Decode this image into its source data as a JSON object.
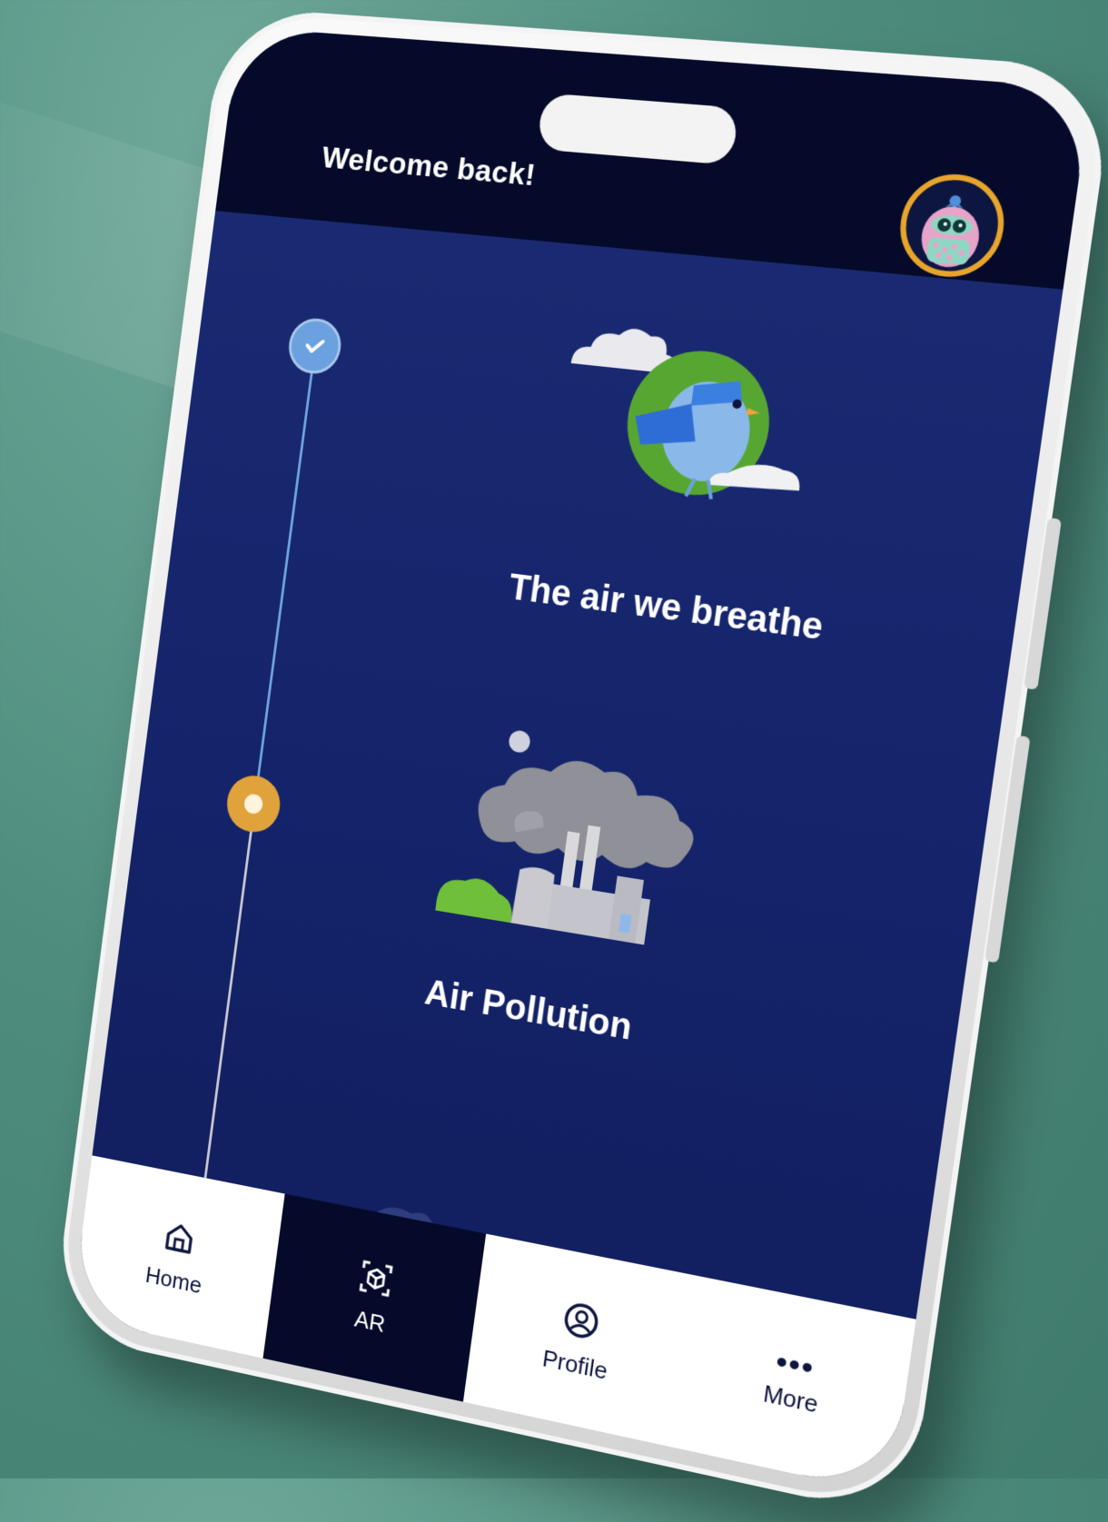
{
  "header": {
    "welcome_text": "Welcome back!"
  },
  "lessons": [
    {
      "title": "The air we breathe",
      "status": "completed"
    },
    {
      "title": "Air Pollution",
      "status": "current"
    },
    {
      "title": "",
      "status": "ar"
    }
  ],
  "nav": {
    "items": [
      {
        "label": "Home",
        "icon": "home-icon"
      },
      {
        "label": "AR",
        "icon": "ar-cube-icon",
        "active": true
      },
      {
        "label": "Profile",
        "icon": "profile-icon"
      },
      {
        "label": "More",
        "icon": "more-icon"
      }
    ]
  },
  "colors": {
    "background": "#4e8d7e",
    "header": "#050a2a",
    "screen": "#14236a",
    "accent_gold": "#e0a33b",
    "completed_blue": "#6aa1de",
    "ar_green": "#7ec9b0"
  }
}
